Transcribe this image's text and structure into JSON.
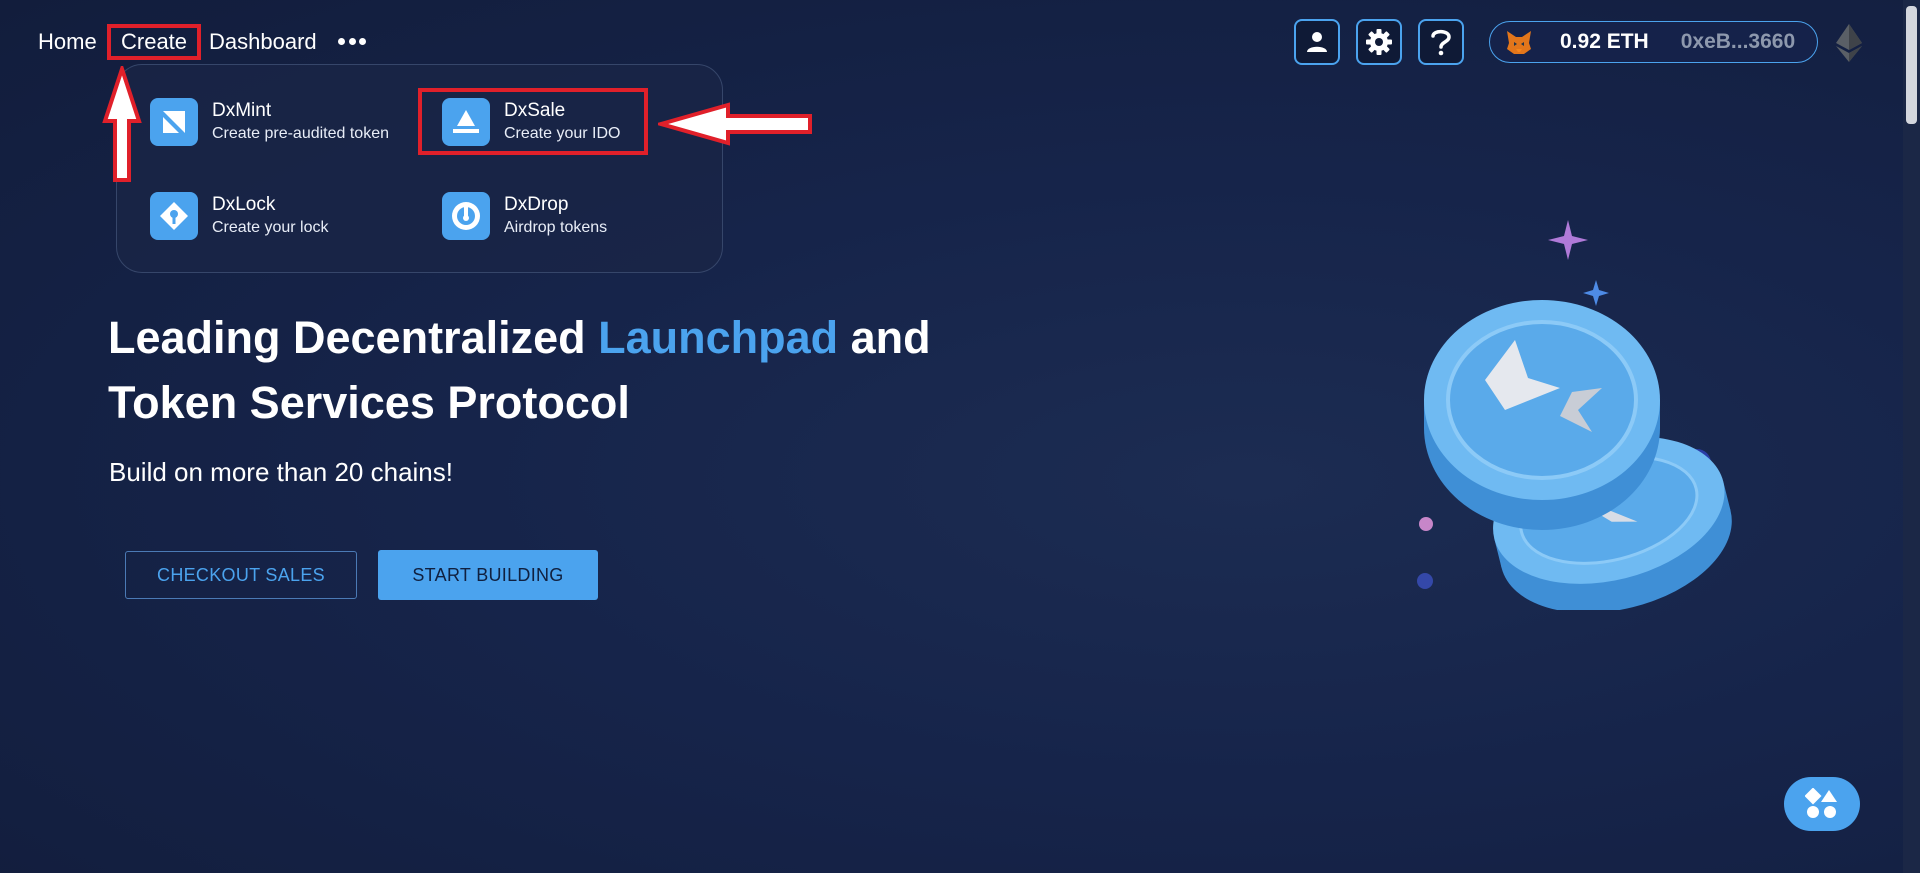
{
  "nav": {
    "home": "Home",
    "create": "Create",
    "dashboard": "Dashboard",
    "more_icon": "more-dots-icon"
  },
  "dropdown": {
    "items": [
      {
        "title": "DxMint",
        "subtitle": "Create pre-audited token",
        "icon": "dxmint-icon"
      },
      {
        "title": "DxSale",
        "subtitle": "Create your IDO",
        "icon": "dxsale-icon"
      },
      {
        "title": "DxLock",
        "subtitle": "Create your lock",
        "icon": "dxlock-icon"
      },
      {
        "title": "DxDrop",
        "subtitle": "Airdrop tokens",
        "icon": "dxdrop-icon"
      }
    ]
  },
  "header_right": {
    "account_icon": "user-icon",
    "settings_icon": "gear-icon",
    "help_icon": "question-icon",
    "wallet": {
      "balance": "0.92 ETH",
      "address": "0xeB...3660",
      "icon": "metamask-fox-icon"
    },
    "network_icon": "ethereum-icon"
  },
  "hero": {
    "title_part1": "Leading Decentralized ",
    "title_accent": "Launchpad",
    "title_part2": " and Token Services Protocol",
    "subtitle": "Build on more than 20 chains!",
    "checkout_button": "CHECKOUT SALES",
    "start_button": "START BUILDING"
  },
  "fab_icon": "apps-shapes-icon",
  "colors": {
    "accent": "#4ba3ee",
    "background": "#16244a",
    "annotation_red": "#e0202a"
  }
}
